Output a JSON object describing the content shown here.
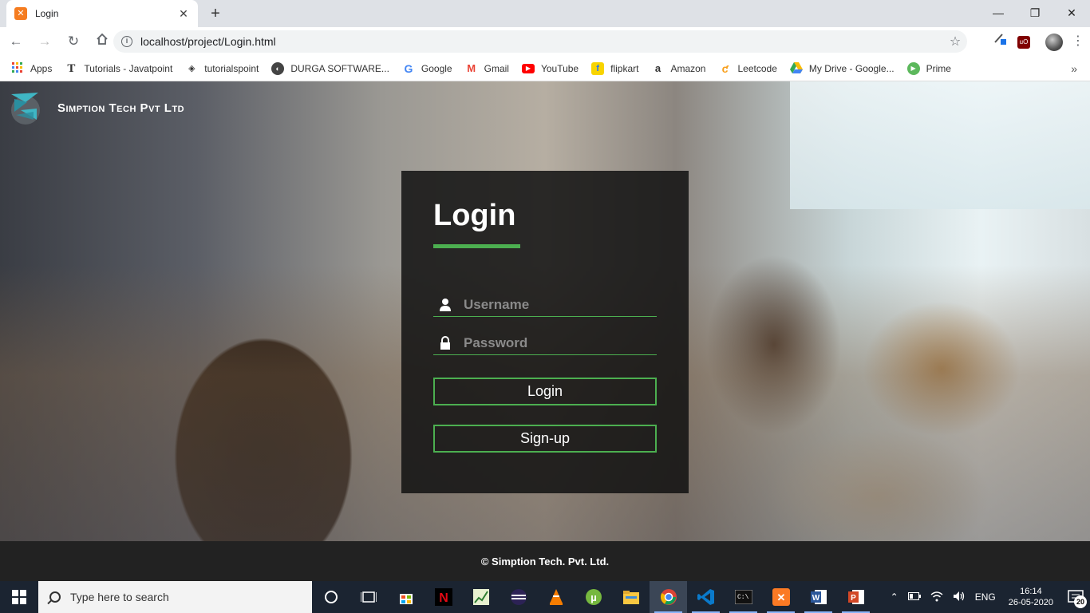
{
  "browser": {
    "tab_title": "Login",
    "tab_close": "✕",
    "new_tab": "+",
    "url": "localhost/project/Login.html",
    "window_controls": {
      "minimize": "—",
      "maximize": "❐",
      "close": "✕"
    }
  },
  "bookmarks": [
    {
      "label": "Apps",
      "icon": "apps-grid-icon"
    },
    {
      "label": "Tutorials - Javatpoint",
      "icon": "javatpoint-icon"
    },
    {
      "label": "tutorialspoint",
      "icon": "tutorialspoint-icon"
    },
    {
      "label": "DURGA SOFTWARE...",
      "icon": "durga-icon"
    },
    {
      "label": "Google",
      "icon": "google-icon"
    },
    {
      "label": "Gmail",
      "icon": "gmail-icon"
    },
    {
      "label": "YouTube",
      "icon": "youtube-icon"
    },
    {
      "label": "flipkart",
      "icon": "flipkart-icon"
    },
    {
      "label": "Amazon",
      "icon": "amazon-icon"
    },
    {
      "label": "Leetcode",
      "icon": "leetcode-icon"
    },
    {
      "label": "My Drive - Google...",
      "icon": "drive-icon"
    },
    {
      "label": "Prime",
      "icon": "prime-icon"
    }
  ],
  "bookmarks_more": "»",
  "page": {
    "brand_name": "Simption Tech Pvt Ltd",
    "login": {
      "title": "Login",
      "username_placeholder": "Username",
      "password_placeholder": "Password",
      "login_button": "Login",
      "signup_button": "Sign-up"
    },
    "footer": "© Simption Tech. Pvt. Ltd."
  },
  "taskbar": {
    "search_placeholder": "Type here to search",
    "language": "ENG",
    "time": "16:14",
    "date": "26-05-2020",
    "notification_count": "20"
  },
  "colors": {
    "accent_green": "#4caf50",
    "login_panel": "#111111",
    "footer_bg": "#222222",
    "taskbar_bg": "#1b2431"
  }
}
